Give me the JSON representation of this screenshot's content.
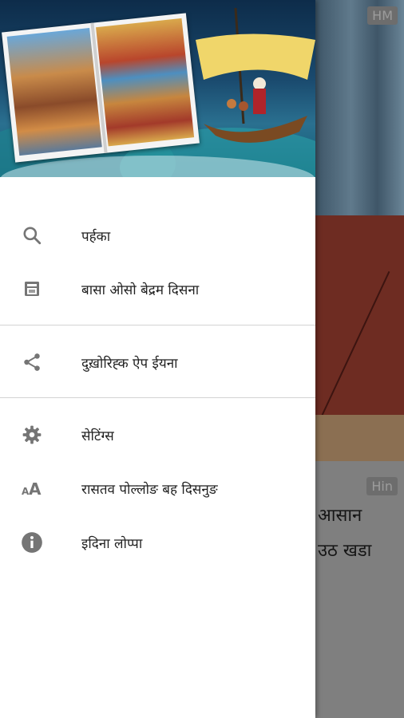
{
  "background": {
    "top_badge": "HM",
    "section_badge": "Hin",
    "text_lines": [
      "आसान",
      "उठ खडा"
    ]
  },
  "drawer": {
    "items": [
      {
        "id": "search",
        "label": "पर्हका",
        "icon": "search-icon"
      },
      {
        "id": "bookmark",
        "label": "बासा ओसो बेद्रम दिसना",
        "icon": "bookmark-icon"
      },
      {
        "id": "share",
        "label": "दुख़ोरिह्क ऐप ईयना",
        "icon": "share-icon"
      },
      {
        "id": "settings",
        "label": "सेटिंग्स",
        "icon": "settings-icon"
      },
      {
        "id": "text-size",
        "label": "रासतव पोल्लोङ बह दिसनुङ",
        "icon": "text-size-icon"
      },
      {
        "id": "about",
        "label": "इदिना लोप्पा",
        "icon": "info-icon"
      }
    ]
  },
  "colors": {
    "icon": "#757575",
    "text": "#222222",
    "divider": "#d3d3d3"
  }
}
